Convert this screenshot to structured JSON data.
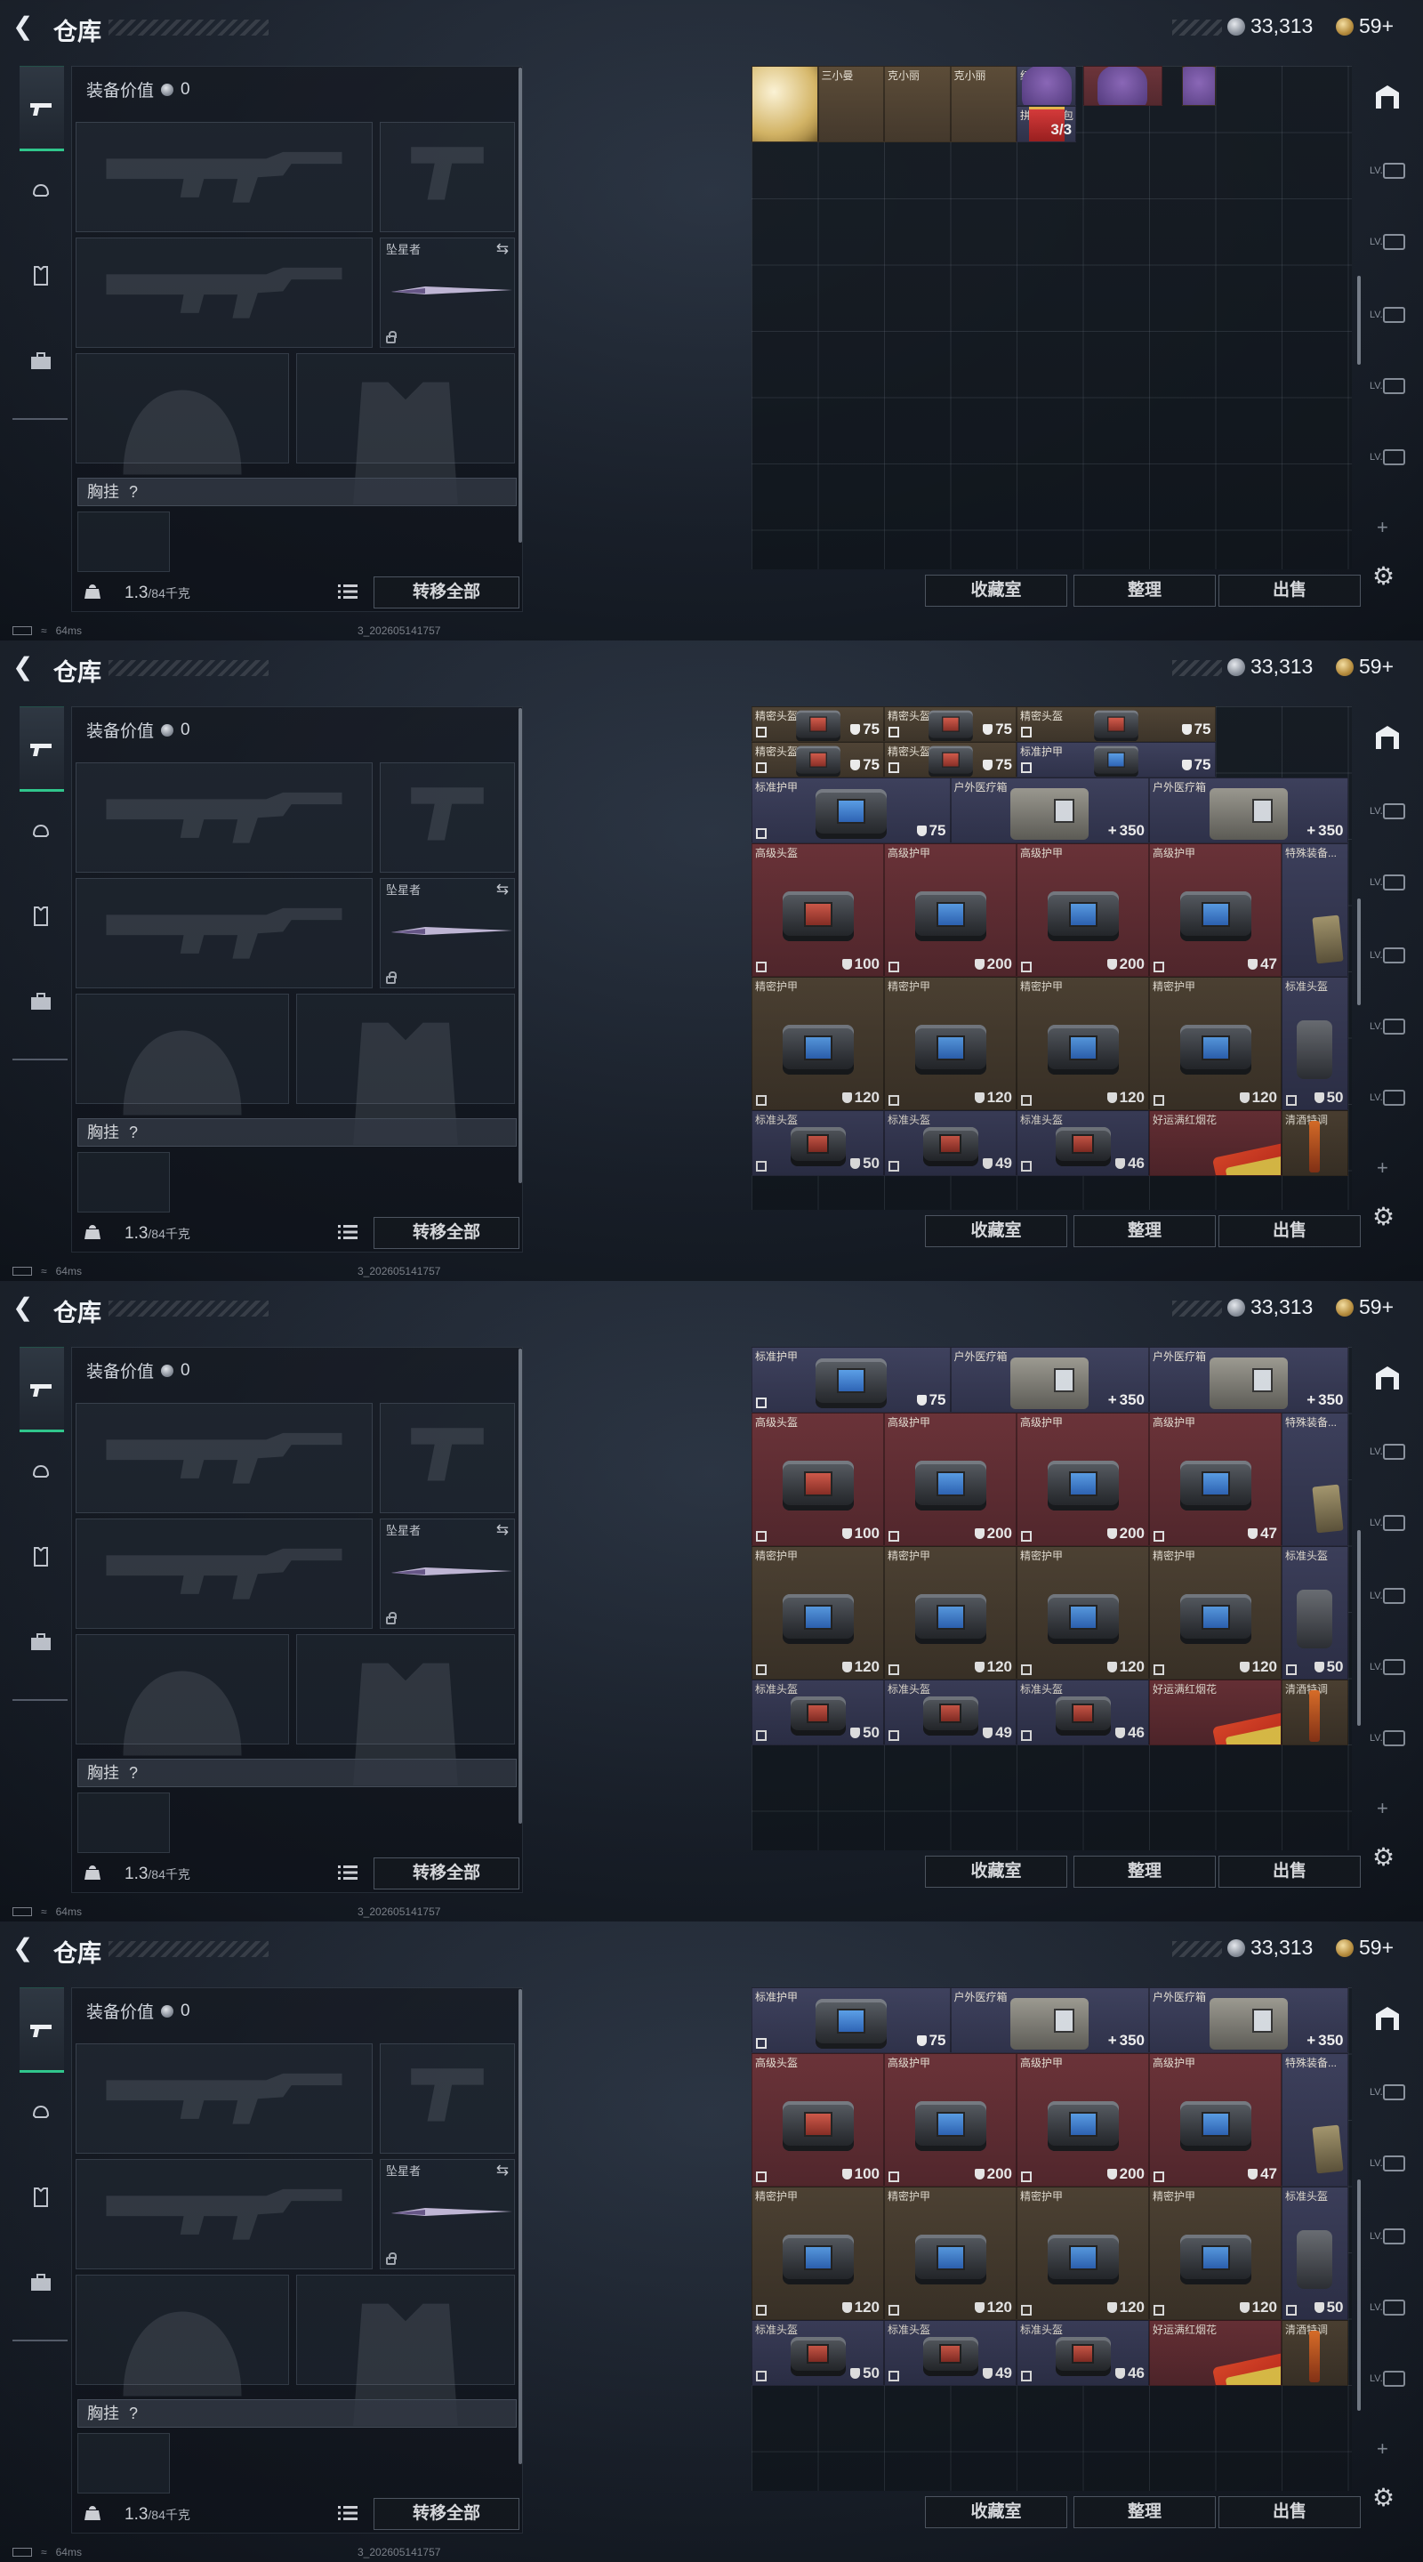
{
  "topbar": {
    "title": "仓库",
    "silver": "33,313",
    "gold": "59+"
  },
  "equip": {
    "value_label": "装备价值",
    "value": "0",
    "knife_label": "坠星者",
    "chest_label": "胸挂",
    "chest_hint": "?",
    "weight": "1.3",
    "weight_max": "/84千克",
    "transfer_all": "转移全部"
  },
  "status": {
    "ping": "64ms",
    "version": "3_202605141757"
  },
  "buttons": {
    "collection": "收藏室",
    "organize": "整理",
    "sell": "出售"
  },
  "side_labels": [
    "LV.",
    "LV.",
    "LV.",
    "LV.",
    "LV."
  ],
  "frame1_items": [
    {
      "name": "黄金足球",
      "img": "ball"
    },
    {
      "name": "三小曼",
      "img": "doll"
    },
    {
      "name": "克小丽",
      "img": "doll"
    },
    {
      "name": "克小丽",
      "img": "doll"
    },
    {
      "name": "红运福袋",
      "img": "purse"
    },
    {
      "name": "拼手气红包",
      "count": "3/3",
      "img": "redpack"
    }
  ],
  "items_full": [
    {
      "name": "精密头盔",
      "val": "75"
    },
    {
      "name": "精密头盔",
      "val": "75"
    },
    {
      "name": "精密头盔",
      "val": "75"
    },
    {
      "name": "精密头盔",
      "val": "75"
    },
    {
      "name": "精密头盔",
      "val": "75"
    },
    {
      "name": "标准护甲",
      "val": "75"
    },
    {
      "name": "标准护甲",
      "val": "75"
    },
    {
      "name": "户外医疗箱",
      "val": "350"
    },
    {
      "name": "户外医疗箱",
      "val": "350"
    },
    {
      "name": "高级头盔",
      "val": "100"
    },
    {
      "name": "高级护甲",
      "val": "200"
    },
    {
      "name": "高级护甲",
      "val": "200"
    },
    {
      "name": "高级护甲",
      "val": "47"
    },
    {
      "name": "特殊装备..."
    },
    {
      "name": "精密护甲",
      "val": "120"
    },
    {
      "name": "精密护甲",
      "val": "120"
    },
    {
      "name": "精密护甲",
      "val": "120"
    },
    {
      "name": "精密护甲",
      "val": "120"
    },
    {
      "name": "标准头盔",
      "val": "50"
    },
    {
      "name": "标准头盔",
      "val": "50"
    },
    {
      "name": "标准头盔",
      "val": "49"
    },
    {
      "name": "标准头盔",
      "val": "46"
    },
    {
      "name": "好运满红烟花"
    },
    {
      "name": "清酒特调"
    }
  ]
}
